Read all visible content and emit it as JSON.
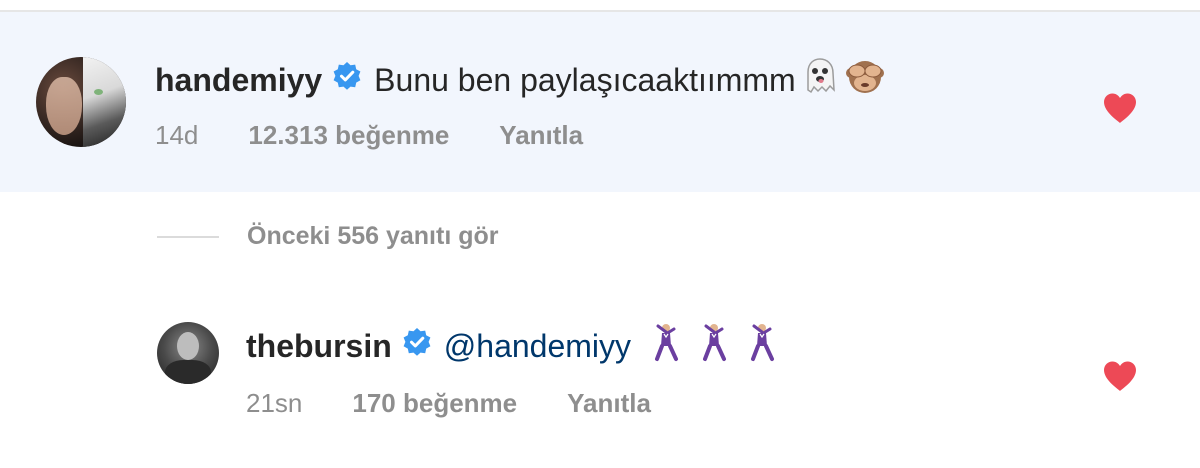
{
  "comments": [
    {
      "username": "handemiyy",
      "verified": true,
      "text": "Bunu ben paylaşıcaaktıımmm",
      "emojis": [
        "ghost-emoji",
        "see-no-evil-monkey-emoji"
      ],
      "time": "14d",
      "likes": "12.313 beğenme",
      "reply_label": "Yanıtla",
      "liked": true
    },
    {
      "username": "thebursin",
      "verified": true,
      "mention": "@handemiyy",
      "emojis": [
        "man-dancing-emoji",
        "man-dancing-emoji",
        "man-dancing-emoji"
      ],
      "time": "21sn",
      "likes": "170 beğenme",
      "reply_label": "Yanıtla",
      "liked": true
    }
  ],
  "view_previous_replies": "Önceki 556 yanıtı gör",
  "colors": {
    "verified": "#3897f0",
    "heart": "#ed4956",
    "highlight_bg": "#f2f6fd",
    "muted_text": "#8e8e8e",
    "primary_text": "#262626",
    "mention": "#00376b"
  }
}
